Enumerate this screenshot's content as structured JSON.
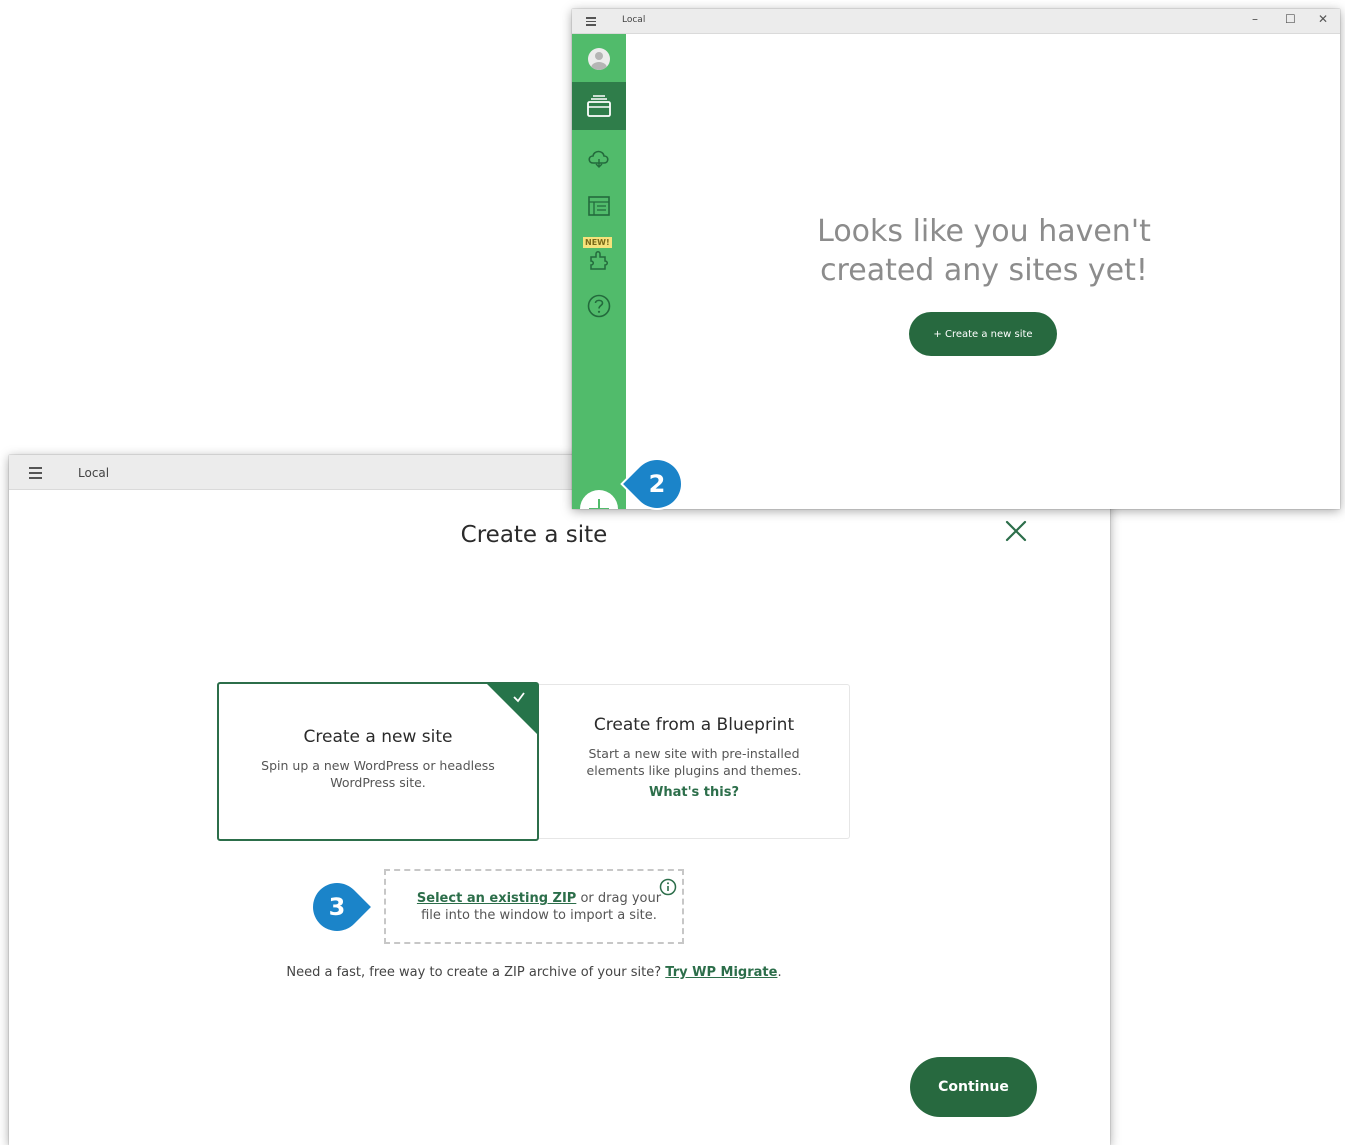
{
  "colors": {
    "brand_green": "#27693f",
    "sidebar_green": "#51bb6b",
    "sidebar_active": "#2f7d4a",
    "callout_blue": "#1b84c9",
    "new_badge": "#f6e27b"
  },
  "create_window": {
    "titlebar_title": "Local",
    "modal_title": "Create a site",
    "close_icon": "close-x-icon",
    "cards": {
      "new_site": {
        "title": "Create a new site",
        "description": "Spin up a new WordPress or headless WordPress site.",
        "selected": true
      },
      "blueprint": {
        "title": "Create from a Blueprint",
        "description": "Start a new site with pre-installed elements like plugins and themes.",
        "link": "What's this?"
      }
    },
    "zip_import": {
      "link": "Select an existing ZIP",
      "text": " or drag your file into the window to import a site."
    },
    "migrate": {
      "text": "Need a fast, free way to create a ZIP archive of your site? ",
      "link": "Try WP Migrate",
      "suffix": "."
    },
    "continue_label": "Continue"
  },
  "local_window": {
    "titlebar_title": "Local",
    "window_controls": {
      "minimize": "–",
      "maximize": "☐",
      "close": "✕"
    },
    "sidebar": {
      "items": [
        {
          "icon": "avatar-icon"
        },
        {
          "icon": "sites-icon",
          "active": true
        },
        {
          "icon": "cloud-icon"
        },
        {
          "icon": "blueprints-icon",
          "badge": "NEW!"
        },
        {
          "icon": "addons-icon"
        },
        {
          "icon": "help-icon"
        }
      ],
      "add_button_icon": "plus-icon"
    },
    "empty_state": {
      "message_line1": "Looks like you haven't",
      "message_line2": "created any sites yet!",
      "button_label": "+  Create a new site"
    }
  },
  "callouts": {
    "step2": "2",
    "step3": "3"
  }
}
